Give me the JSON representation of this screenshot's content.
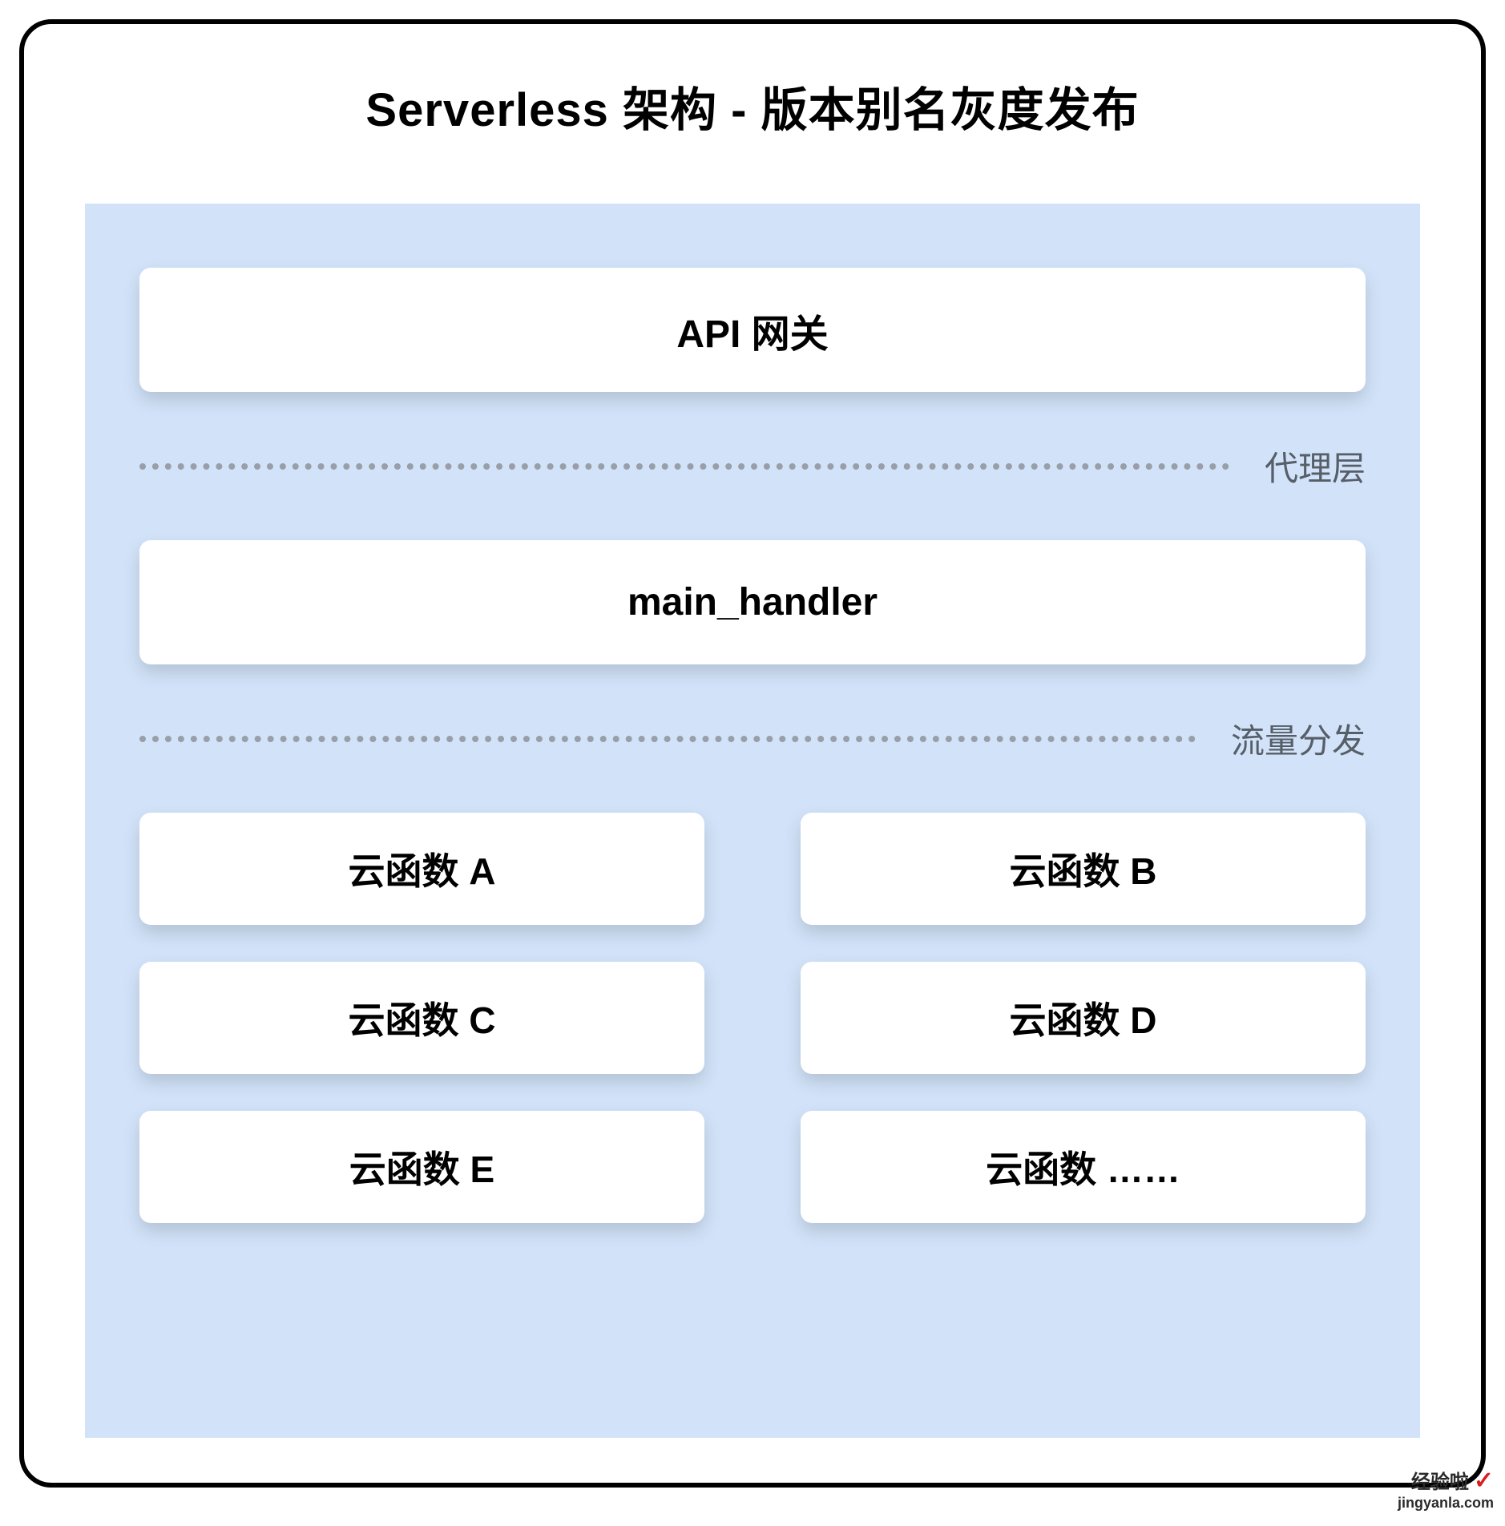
{
  "title": "Serverless 架构 - 版本别名灰度发布",
  "gateway": {
    "label": "API 网关"
  },
  "dividers": {
    "proxy": "代理层",
    "traffic": "流量分发"
  },
  "handler": {
    "label": "main_handler"
  },
  "functions": [
    "云函数 A",
    "云函数 B",
    "云函数 C",
    "云函数 D",
    "云函数 E",
    "云函数 ……"
  ],
  "watermark": {
    "brand": "经验啦",
    "domain": "jingyanla.com"
  }
}
